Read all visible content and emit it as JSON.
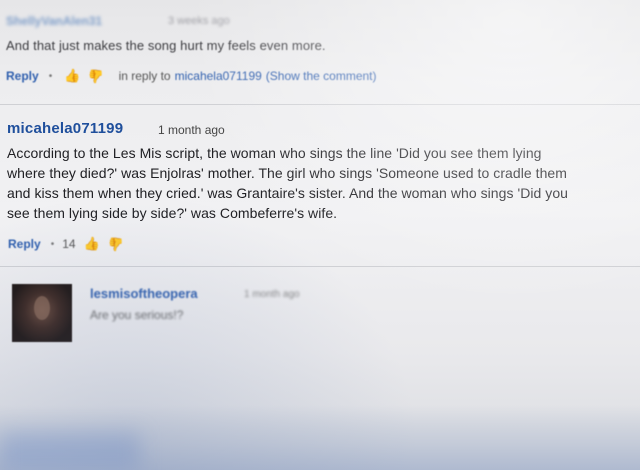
{
  "comments": [
    {
      "author": "ShellyVanAlen31",
      "time": "3 weeks ago",
      "text": "And that just makes the song hurt my feels even more.",
      "reply_label": "Reply",
      "in_reply_to": "in reply to",
      "reply_target": "micahela071199",
      "show_comment": "(Show the comment)"
    },
    {
      "author": "micahela071199",
      "time": "1 month ago",
      "lines": [
        "According to the Les Mis script, the woman who sings the line 'Did you see them lying",
        "where they died?' was Enjolras' mother. The girl who sings 'Someone used to cradle them",
        "and kiss them when they cried.' was Grantaire's sister. And the woman who sings 'Did you",
        "see them lying side by side?' was Combeferre's wife."
      ],
      "reply_label": "Reply",
      "likes": "14"
    },
    {
      "author": "lesmisoftheopera",
      "time": "1 month ago",
      "text": "Are you serious!?"
    }
  ],
  "icons": {
    "thumb_up": "thumbs-up-icon",
    "thumb_down": "thumbs-down-icon"
  },
  "colors": {
    "link": "#2f5fae",
    "author": "#1f4f9c",
    "text": "#202024"
  }
}
